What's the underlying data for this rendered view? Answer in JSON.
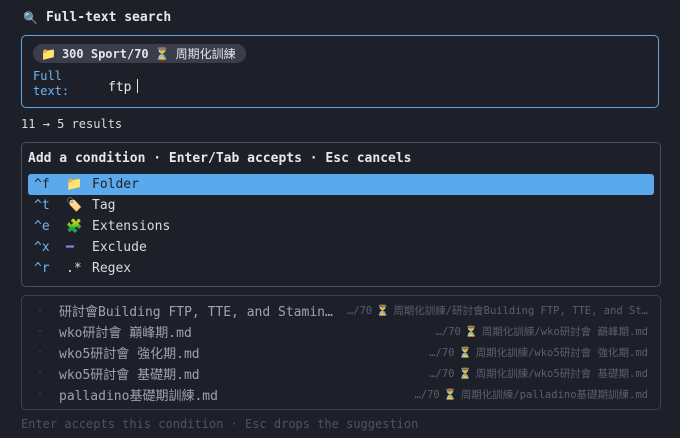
{
  "header": {
    "icon": "magnifier-icon",
    "title": "Full-text search"
  },
  "scope_chip": {
    "folder_icon": "folder-icon",
    "label": "300 Sport/70",
    "hourglass_icon": "hourglass-icon",
    "sublabel": "周期化訓練"
  },
  "field": {
    "label": "Full\ntext:",
    "value": "ftp"
  },
  "result_count": "11 → 5 results",
  "conditions": {
    "heading": "Add a condition · Enter/Tab accepts · Esc cancels",
    "items": [
      {
        "key": "^f",
        "icon": "folder-icon",
        "glyph": "📁",
        "label": "Folder",
        "selected": true
      },
      {
        "key": "^t",
        "icon": "tag-icon",
        "glyph": "🏷️",
        "label": "Tag",
        "selected": false
      },
      {
        "key": "^e",
        "icon": "puzzle-icon",
        "glyph": "🧩",
        "label": "Extensions",
        "selected": false
      },
      {
        "key": "^x",
        "icon": "minus-icon",
        "glyph": "━",
        "label": "Exclude",
        "selected": false
      },
      {
        "key": "^r",
        "icon": "regex-icon",
        "glyph": ".*",
        "label": "Regex",
        "selected": false
      }
    ]
  },
  "results": [
    {
      "name": "研討會Building FTP, TTE, and Stamin…",
      "path_prefix": "…/70",
      "path_rest": "周期化訓練/研討會Building FTP, TTE, and St…"
    },
    {
      "name": "wko研討會 巔峰期.md",
      "path_prefix": "…/70",
      "path_rest": "周期化訓練/wko研討會 巔峰期.md"
    },
    {
      "name": "wko5研討會 強化期.md",
      "path_prefix": "…/70",
      "path_rest": "周期化訓練/wko5研討會 強化期.md"
    },
    {
      "name": "wko5研討會 基礎期.md",
      "path_prefix": "…/70",
      "path_rest": "周期化訓練/wko5研討會 基礎期.md"
    },
    {
      "name": "palladino基礎期訓練.md",
      "path_prefix": "…/70",
      "path_rest": "周期化訓練/palladino基礎期訓練.md"
    }
  ],
  "footer": "Enter accepts this condition  ·  Esc drops the suggestion",
  "colors": {
    "accent": "#5aa9ec",
    "background": "#1e2029",
    "hourglass": "#e9b94a"
  }
}
